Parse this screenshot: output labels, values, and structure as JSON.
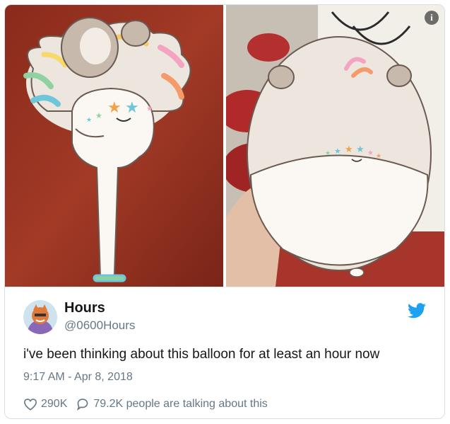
{
  "tweet": {
    "author_name": "Hours",
    "author_handle": "@0600Hours",
    "text": "i've been thinking about this balloon for at least an hour now",
    "timestamp": "9:17 AM - Apr 8, 2018",
    "likes": "290K",
    "conversation": "79.2K people are talking about this"
  },
  "icons": {
    "info": "info-icon",
    "bird": "twitter-bird-icon",
    "heart": "heart-icon",
    "reply": "reply-bubble-icon"
  },
  "colors": {
    "twitter_blue": "#1da1f2",
    "secondary_text": "#657786",
    "border": "#d8dee2"
  }
}
